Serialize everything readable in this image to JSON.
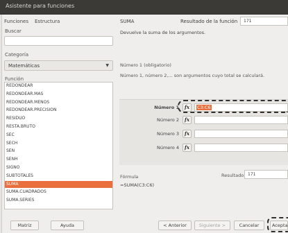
{
  "window": {
    "title": "Asistente para funciones"
  },
  "tabs": [
    {
      "label": "Funciones"
    },
    {
      "label": "Estructura"
    }
  ],
  "search": {
    "label": "Buscar",
    "value": ""
  },
  "category": {
    "label": "Categoría",
    "value": "Matemáticas"
  },
  "function_list": {
    "label": "Función",
    "items": [
      "REDONDEAR",
      "REDONDEAR.MAS",
      "REDONDEAR.MENOS",
      "REDONDEAR.PRECISION",
      "RESIDUO",
      "RESTA.BRUTO",
      "SEC",
      "SECH",
      "SEN",
      "SENH",
      "SIGNO",
      "SUBTOTALES",
      "SUMA",
      "SUMA.CUADRADOS",
      "SUMA.SERIES"
    ],
    "selected_index": 12
  },
  "detail": {
    "function_name": "SUMA",
    "function_result_label": "Resultado de la función",
    "function_result_value": "171",
    "description": "Devuelve la suma de los argumentos.",
    "argument_title": "Número 1 (obligatorio)",
    "argument_description": "Número 1, número 2,... son argumentos cuyo total se calculará."
  },
  "arguments": [
    {
      "label": "Número 1",
      "fx": "fx",
      "value": "C3:C6",
      "focused": true
    },
    {
      "label": "Número 2",
      "fx": "fx",
      "value": ""
    },
    {
      "label": "Número 3",
      "fx": "fx",
      "value": ""
    },
    {
      "label": "Número 4",
      "fx": "fx",
      "value": ""
    }
  ],
  "formula": {
    "label": "Fórmula",
    "value": "=SUMA(C3:C6)"
  },
  "result": {
    "label": "Resultado",
    "value": "171"
  },
  "buttons": {
    "array": "Matriz",
    "help": "Ayuda",
    "back": "< Anterior",
    "next": "Siguiente >",
    "cancel": "Cancelar",
    "ok": "Aceptar"
  }
}
